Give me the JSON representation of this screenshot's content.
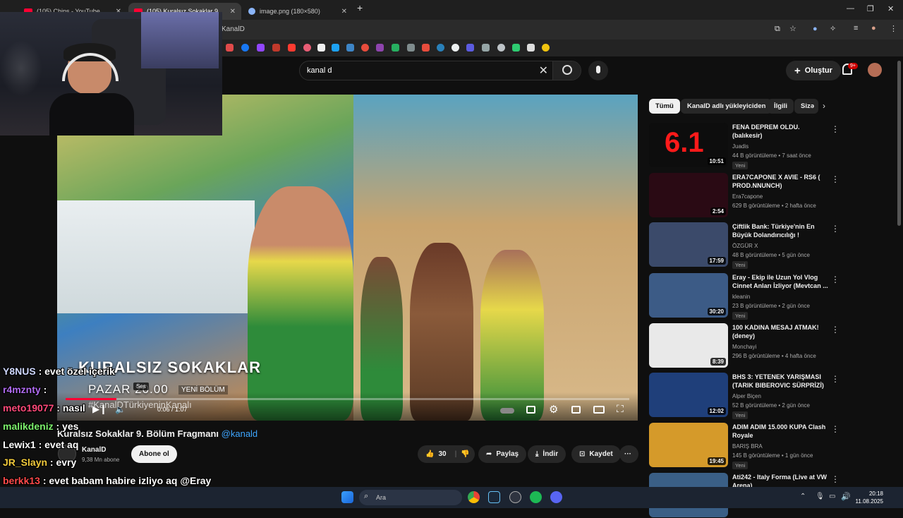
{
  "browser": {
    "tabs": [
      {
        "title": "(105) Chips - YouTube"
      },
      {
        "title": "(105) Kuralsız Sokaklar 9. Bö"
      },
      {
        "title": "image.png (180×580)"
      }
    ],
    "url": "KanalD"
  },
  "youtube": {
    "search_value": "kanal d",
    "create_label": "Oluştur",
    "notification_badge": "9+"
  },
  "video": {
    "overlay_title": "KURALSIZ SOKAKLAR",
    "overlay_day": "PAZAR 20.00",
    "overlay_badge": "YENİ BÖLÜM",
    "watermark": "#KanalDTürkiyeninKanalı",
    "tooltip": "Ses",
    "time": "0:06 / 1:07",
    "progress": 0.09,
    "title": "Kuralsız Sokaklar 9. Bölüm Fragmanı",
    "title_tag": "@kanald",
    "channel": "KanalD",
    "subscribers": "9,38 Mn abone",
    "subscribe_label": "Abone ol",
    "likes": "30",
    "share_label": "Paylaş",
    "download_label": "İndir",
    "save_label": "Kaydet"
  },
  "chips": [
    "Tümü",
    "KanalD adlı yükleyiciden",
    "İlgili",
    "Sizə"
  ],
  "related": [
    {
      "title": "FENA DEPREM OLDU. (balıkesir)",
      "channel": "Juadis",
      "meta": "44 B görüntüleme • 7 saat önce",
      "duration": "10:51",
      "badge": "Yeni",
      "thumb_color": "#0d0d0d"
    },
    {
      "title": "ERA7CAPONE X AVIE - RS6 ( PROD.NNUNCH)",
      "channel": "Era7capone",
      "meta": "629 B görüntüleme • 2 hafta önce",
      "duration": "2:54",
      "badge": "",
      "thumb_color": "#2a0a14"
    },
    {
      "title": "Çiftlik Bank: Türkiye'nin En Büyük Dolandırıcılığı !",
      "channel": "ÖZGÜR X",
      "meta": "48 B görüntüleme • 5 gün önce",
      "duration": "17:59",
      "badge": "Yeni",
      "thumb_color": "#3b4a6a"
    },
    {
      "title": "Eray - Ekip ile Uzun Yol Vlog Cinnet Anları İzliyor (Mevtcan ...",
      "channel": "kleanin",
      "meta": "23 B görüntüleme • 2 gün önce",
      "duration": "30:20",
      "badge": "Yeni",
      "thumb_color": "#3c5b86"
    },
    {
      "title": "100 KADINA MESAJ ATMAK! (deney)",
      "channel": "Monchayi",
      "meta": "296 B görüntüleme • 4 hafta önce",
      "duration": "8:39",
      "badge": "",
      "thumb_color": "#e9e9e9"
    },
    {
      "title": "BHS 3: YETENEK YARIŞMASI (TARIK BIBEROVIC SÜRPRİZİ)",
      "channel": "Alper Biçen",
      "meta": "52 B görüntüleme • 2 gün önce",
      "duration": "12:02",
      "badge": "Yeni",
      "thumb_color": "#1f3f7a"
    },
    {
      "title": "ADIM ADIM 15.000 KUPA Clash Royale",
      "channel": "BARIŞ BRA",
      "meta": "145 B görüntüleme • 1 gün önce",
      "duration": "19:45",
      "badge": "Yeni",
      "thumb_color": "#d59a2a"
    },
    {
      "title": "Ati242 - Italy Forma (Live at VW Arena)",
      "channel": "",
      "meta": "",
      "duration": "",
      "badge": "",
      "thumb_color": "#3a5f86"
    }
  ],
  "chat": [
    {
      "user": "Y8NUS",
      "text": " : evet özel içerik",
      "color": "#cfd8ff"
    },
    {
      "user": "r4mznty",
      "text": " : ",
      "color": "#b06cf0"
    },
    {
      "user": "meto19077",
      "text": " : nasıl",
      "color": "#ff4a7a"
    },
    {
      "user": "malikdeniz",
      "text": " : yes",
      "color": "#7cf06c"
    },
    {
      "user": "Lewix1",
      "text": " : evet aq",
      "color": "#ffffff"
    },
    {
      "user": "JR_Slayn",
      "text": " : evry",
      "color": "#f0c93c"
    },
    {
      "user": "berkk13",
      "text": " : evet babam habire izliyo aq @Eray",
      "color": "#ff4a4a"
    }
  ],
  "taskbar": {
    "search_label": "Ara",
    "time": "20:18",
    "date": "11.08.2025"
  },
  "colors": {
    "accent": "#ff0033",
    "link": "#3ea6ff"
  }
}
